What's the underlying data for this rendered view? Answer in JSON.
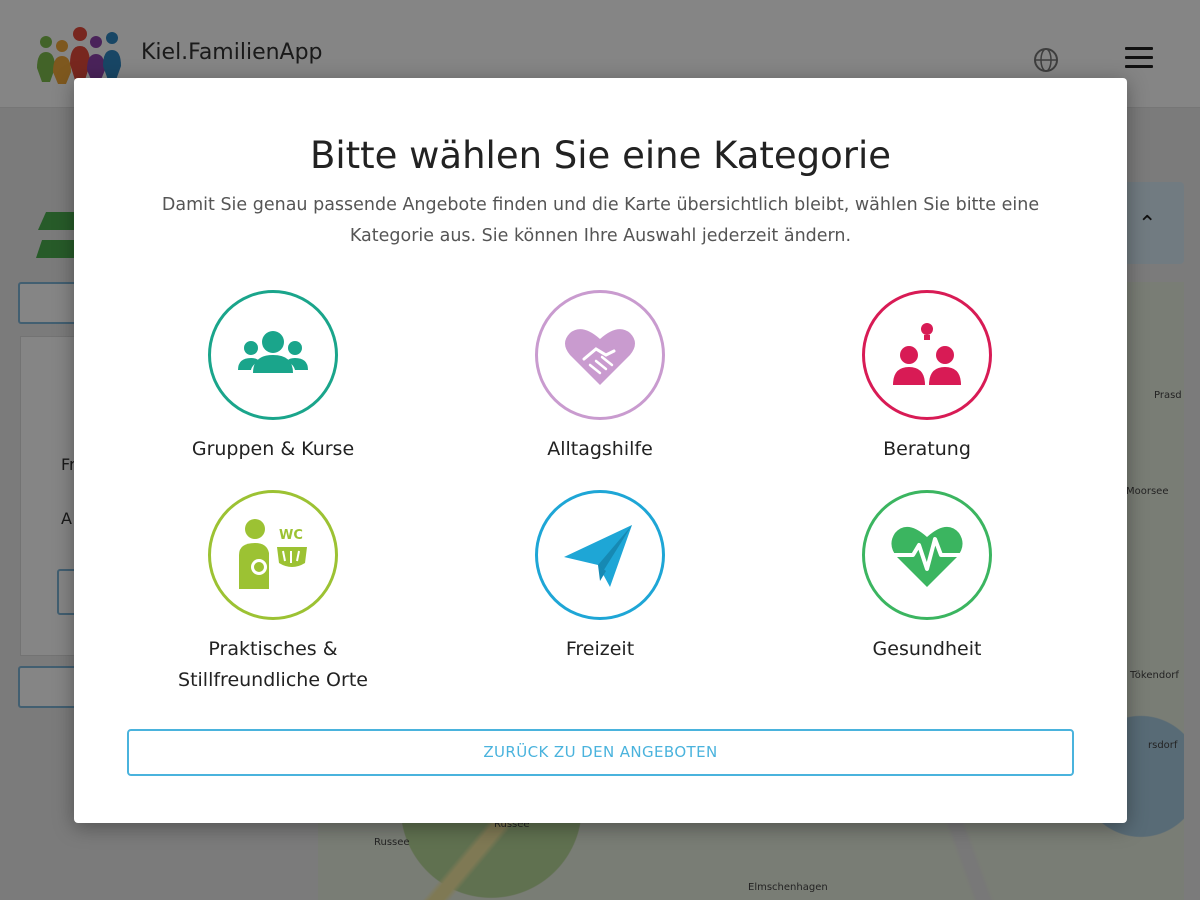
{
  "app": {
    "title": "Kiel.FamilienApp"
  },
  "background": {
    "map_labels": [
      "Russee",
      "Russee",
      "Elmschenhagen",
      "Prasd",
      "Tökendorf",
      "rsdorf",
      "Moorsee"
    ],
    "side_text_1": "Fr",
    "side_text_2": "A"
  },
  "modal": {
    "title": "Bitte wählen Sie eine Kategorie",
    "description": "Damit Sie genau passende Angebote finden und die Karte übersichtlich bleibt, wählen Sie bitte eine Kategorie aus. Sie können Ihre Auswahl jederzeit ändern.",
    "categories": [
      {
        "label": "Gruppen & Kurse",
        "icon": "group-icon",
        "color": "#1aa58b"
      },
      {
        "label": "Alltagshilfe",
        "icon": "handshake-heart-icon",
        "color": "#c99bcf"
      },
      {
        "label": "Beratung",
        "icon": "consultation-icon",
        "color": "#d81b55"
      },
      {
        "label": "Praktisches & Stillfreundliche Orte",
        "icon": "breastfeeding-wc-icon",
        "color": "#9cc233",
        "wc_text": "WC"
      },
      {
        "label": "Freizeit",
        "icon": "paper-plane-icon",
        "color": "#1ea6d6"
      },
      {
        "label": "Gesundheit",
        "icon": "heart-pulse-icon",
        "color": "#3bb560"
      }
    ],
    "back_button": "ZURÜCK ZU DEN ANGEBOTEN"
  }
}
